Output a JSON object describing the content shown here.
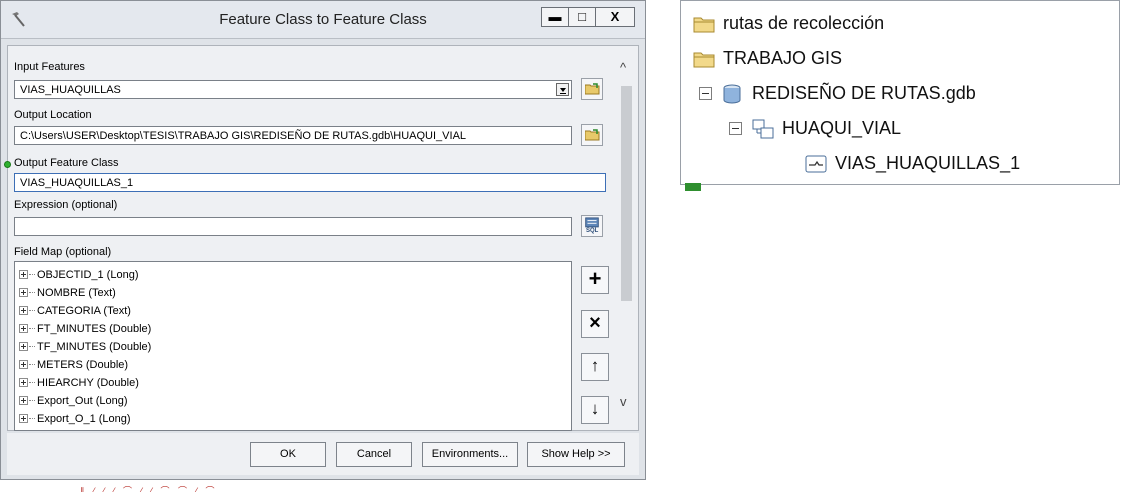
{
  "dialog": {
    "title": "Feature Class to Feature Class",
    "window_buttons": {
      "minimize": "▬",
      "maximize": "□",
      "close": "X"
    },
    "input_features": {
      "label": "Input Features",
      "value": "VIAS_HUAQUILLAS"
    },
    "output_location": {
      "label": "Output Location",
      "value": "C:\\Users\\USER\\Desktop\\TESIS\\TRABAJO GIS\\REDISEÑO DE RUTAS.gdb\\HUAQUI_VIAL"
    },
    "output_feature_class": {
      "label": "Output Feature Class",
      "value": "VIAS_HUAQUILLAS_1"
    },
    "expression": {
      "label": "Expression (optional)",
      "value": "",
      "sql_label": "SQL"
    },
    "field_map": {
      "label": "Field Map (optional)",
      "fields": [
        "OBJECTID_1 (Long)",
        "NOMBRE (Text)",
        "CATEGORIA (Text)",
        "FT_MINUTES (Double)",
        "TF_MINUTES (Double)",
        "METERS (Double)",
        "HIEARCHY (Double)",
        "Export_Out (Long)",
        "Export_O_1 (Long)"
      ],
      "buttons": {
        "add": "+",
        "remove": "×",
        "up": "↑",
        "down": "↓"
      }
    },
    "buttons": {
      "ok": "OK",
      "cancel": "Cancel",
      "environments": "Environments...",
      "help": "Show Help >>"
    }
  },
  "catalog": {
    "items": [
      {
        "label": "rutas de recolección",
        "icon": "folder-icon"
      },
      {
        "label": "TRABAJO GIS",
        "icon": "folder-icon"
      },
      {
        "label": "REDISEÑO DE RUTAS.gdb",
        "icon": "geodatabase-icon"
      },
      {
        "label": "HUAQUI_VIAL",
        "icon": "feature-dataset-icon"
      },
      {
        "label": "VIAS_HUAQUILLAS_1",
        "icon": "line-feature-class-icon"
      }
    ]
  },
  "colors": {
    "accent": "#3d6fb6",
    "required_marker": "#2fb12f",
    "folder": "#e8c96a"
  }
}
